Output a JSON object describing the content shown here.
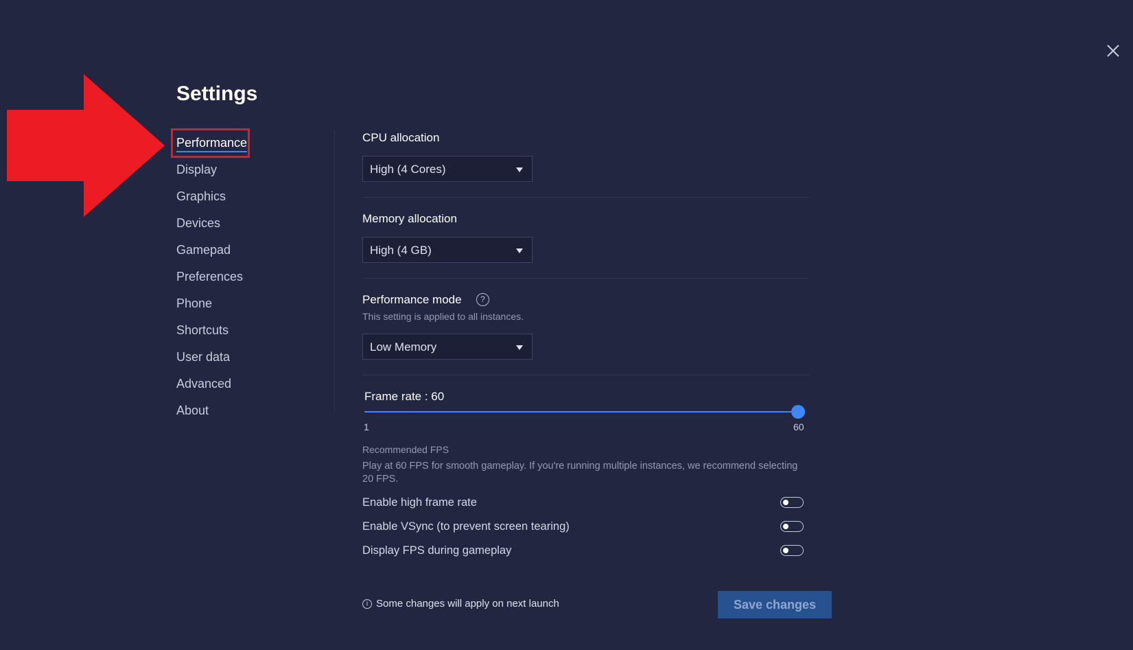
{
  "title": "Settings",
  "nav": {
    "items": [
      {
        "label": "Performance",
        "active": true
      },
      {
        "label": "Display"
      },
      {
        "label": "Graphics"
      },
      {
        "label": "Devices"
      },
      {
        "label": "Gamepad"
      },
      {
        "label": "Preferences"
      },
      {
        "label": "Phone"
      },
      {
        "label": "Shortcuts"
      },
      {
        "label": "User data"
      },
      {
        "label": "Advanced"
      },
      {
        "label": "About"
      }
    ]
  },
  "cpu": {
    "label": "CPU allocation",
    "value": "High (4 Cores)"
  },
  "memory": {
    "label": "Memory allocation",
    "value": "High (4 GB)"
  },
  "perf_mode": {
    "label": "Performance mode",
    "help": "?",
    "note": "This setting is applied to all instances.",
    "value": "Low Memory"
  },
  "frame_rate": {
    "label": "Frame rate : 60",
    "min": "1",
    "max": "60",
    "value": 60,
    "recommended_title": "Recommended FPS",
    "recommended_text": "Play at 60 FPS for smooth gameplay. If you're running multiple instances, we recommend selecting 20 FPS."
  },
  "toggles": [
    {
      "label": "Enable high frame rate",
      "on": false
    },
    {
      "label": "Enable VSync (to prevent screen tearing)",
      "on": false
    },
    {
      "label": "Display FPS during gameplay",
      "on": false
    }
  ],
  "footer": {
    "info_icon": "i",
    "info": "Some changes will apply on next launch",
    "save_label": "Save changes"
  },
  "colors": {
    "background": "#232640",
    "accent": "#3f87f5",
    "save_button": "#27518f",
    "highlight_box": "#e01c22",
    "arrow": "#ed1c24"
  },
  "icons": {
    "close": "close-icon",
    "arrow": "red-arrow-annotation"
  }
}
